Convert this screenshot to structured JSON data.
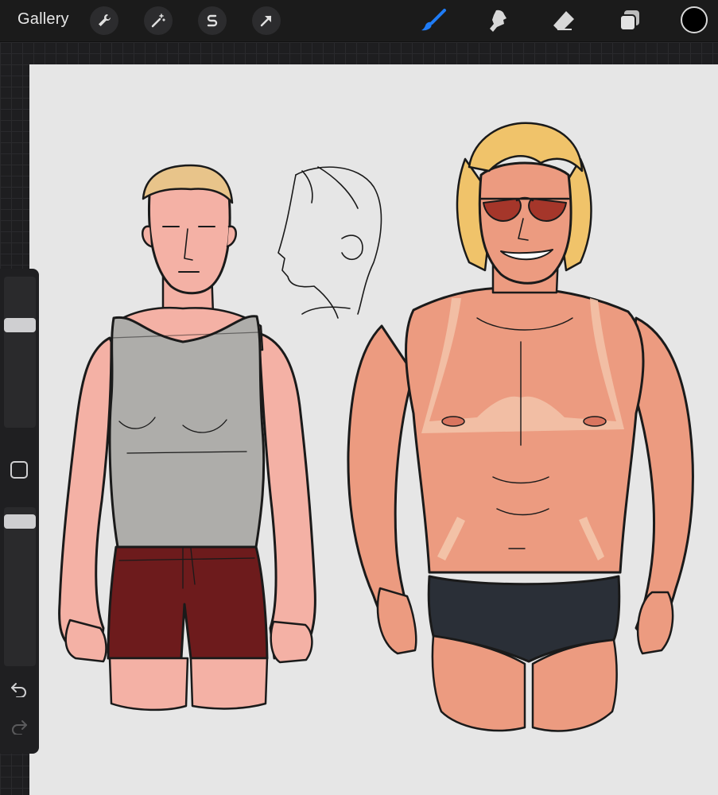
{
  "topbar": {
    "gallery_label": "Gallery",
    "action_icons": [
      "wrench-icon",
      "magic-wand-icon",
      "selection-s-icon",
      "transform-arrow-icon"
    ],
    "tool_icons": [
      "brush-icon",
      "smudge-icon",
      "eraser-icon",
      "layers-icon"
    ],
    "active_tool": "brush-icon",
    "active_tool_color": "#1f7cf6",
    "current_color": "#000000"
  },
  "sidebar": {
    "brush_size": 0.3,
    "brush_opacity": 0.05,
    "icons": [
      "modify-square-icon",
      "undo-icon",
      "redo-icon"
    ]
  },
  "canvas": {
    "background": "#e6e6e6",
    "colors": {
      "skin_pale": "#f4b1a5",
      "skin_tan": "#ec9b80",
      "tan_lines": "#f3c2a7",
      "hair_blond": "#f0c36a",
      "tank_top": "#aeadaa",
      "shorts": "#6d1b1c",
      "briefs": "#2a2f37",
      "sunglasses": "#a5362a"
    }
  }
}
